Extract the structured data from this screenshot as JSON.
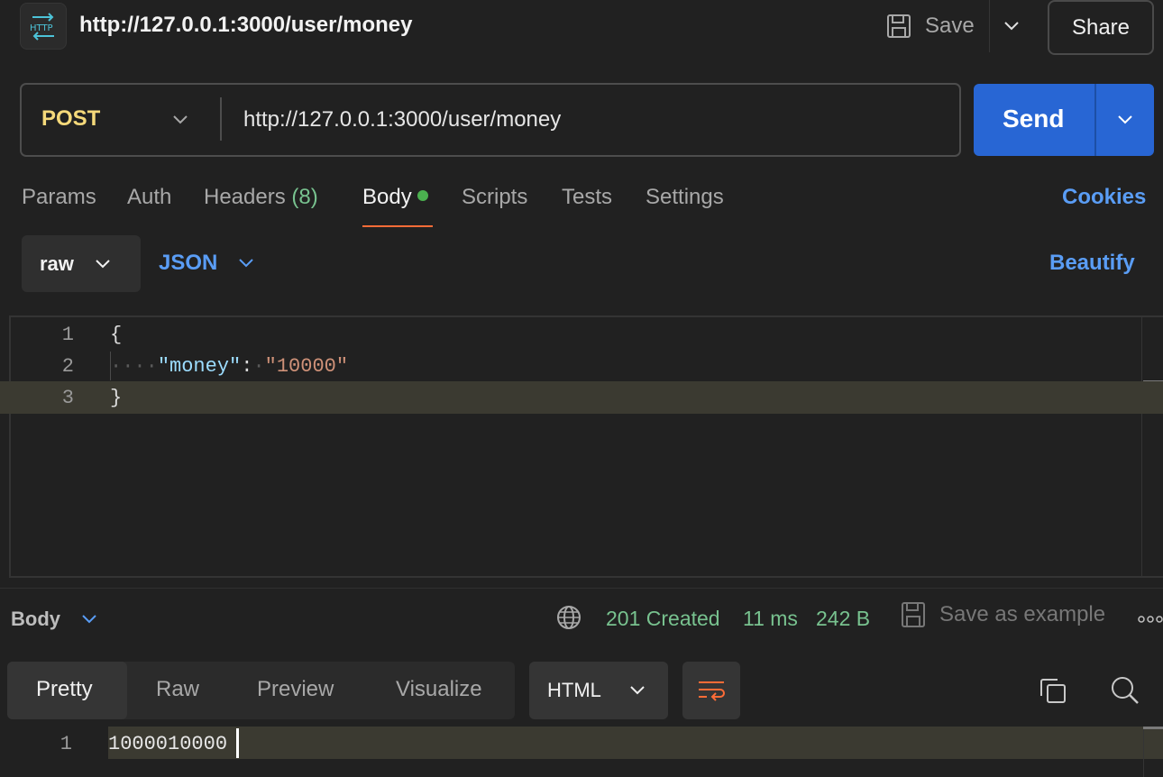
{
  "header": {
    "icon": "http-icon",
    "title": "http://127.0.0.1:3000/user/money",
    "save_label": "Save",
    "share_label": "Share"
  },
  "request": {
    "method": "POST",
    "url": "http://127.0.0.1:3000/user/money",
    "send_label": "Send"
  },
  "tabs": {
    "params": "Params",
    "auth": "Auth",
    "headers": "Headers",
    "headers_count": "(8)",
    "body": "Body",
    "scripts": "Scripts",
    "tests": "Tests",
    "settings": "Settings",
    "cookies": "Cookies"
  },
  "body_options": {
    "mode": "raw",
    "language": "JSON",
    "beautify": "Beautify"
  },
  "editor": {
    "line_numbers": [
      "1",
      "2",
      "3"
    ],
    "line1": "{",
    "line2_indent": "····",
    "line2_key": "\"money\"",
    "line2_colon": ":",
    "line2_space": "·",
    "line2_value": "\"10000\"",
    "line3": "}"
  },
  "response": {
    "body_label": "Body",
    "status": "201 Created",
    "time": "11 ms",
    "size": "242 B",
    "save_example": "Save as example",
    "view_tabs": {
      "pretty": "Pretty",
      "raw": "Raw",
      "preview": "Preview",
      "visualize": "Visualize"
    },
    "format": "HTML",
    "line_number": "1",
    "content": "1000010000"
  },
  "colors": {
    "accent_blue": "#2866d4",
    "link_blue": "#5a9df5",
    "method_yellow": "#f5d97a",
    "status_green": "#78c28f",
    "active_orange": "#ff6c37"
  }
}
